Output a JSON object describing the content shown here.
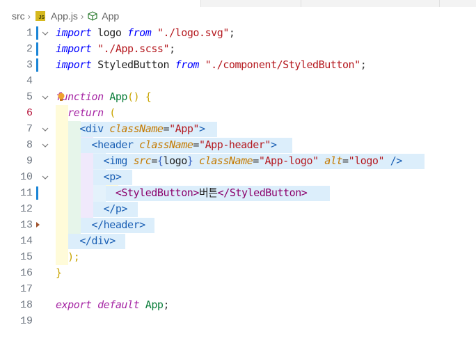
{
  "breadcrumb": {
    "folder": "src",
    "file": "App.js",
    "symbol": "App",
    "file_icon_text": "JS"
  },
  "editor": {
    "active_line": 6,
    "lines": [
      {
        "n": "1"
      },
      {
        "n": "2"
      },
      {
        "n": "3"
      },
      {
        "n": "4"
      },
      {
        "n": "5"
      },
      {
        "n": "6"
      },
      {
        "n": "7"
      },
      {
        "n": "8"
      },
      {
        "n": "9"
      },
      {
        "n": "10"
      },
      {
        "n": "11"
      },
      {
        "n": "12"
      },
      {
        "n": "13"
      },
      {
        "n": "14"
      },
      {
        "n": "15"
      },
      {
        "n": "16"
      },
      {
        "n": "17"
      },
      {
        "n": "18"
      },
      {
        "n": "19"
      }
    ],
    "tokens": {
      "import": "import",
      "from": "from",
      "logo_ident": "logo",
      "logo_path": "\"./logo.svg\"",
      "scss_path": "\"./App.scss\"",
      "styled_ident": "StyledButton",
      "styled_path": "\"./component/StyledButton\"",
      "semicolon": ";",
      "function_kw": "function",
      "app_name": "App",
      "parens_open": "() {",
      "return_kw": "return",
      "paren": "(",
      "div_open": "<div",
      "classname": "className",
      "eq": "=",
      "app_str": "\"App\"",
      "gt": ">",
      "header_open": "<header",
      "app_header_str": "\"App-header\"",
      "img_open": "<img",
      "src_attr": "src",
      "lbrace": "{",
      "rbrace": "}",
      "app_logo_str": "\"App-logo\"",
      "alt_attr": "alt",
      "logo_str": "\"logo\"",
      "self_close": "/>",
      "p_open": "<p>",
      "styled_open": "<StyledButton>",
      "button_text": "버튼",
      "styled_close": "</StyledButton>",
      "p_close": "</p>",
      "header_close": "</header>",
      "div_close": "</div>",
      "close_paren": ");",
      "close_brace": "}",
      "export_kw": "export",
      "default_kw": "default",
      "app_export": "App"
    }
  },
  "colors": {
    "keyword": "#0000ff",
    "string": "#b5191f",
    "function": "#0a7d3a",
    "attribute": "#c47a00",
    "tag": "#8b006b",
    "selection": "#dceefb",
    "modified_bar": "#1a85d6"
  },
  "icons": {
    "file_icon": "javascript-file-icon",
    "symbol_icon": "cube-icon",
    "fold_icon": "chevron-down-icon",
    "lightbulb": "lightbulb-icon"
  }
}
